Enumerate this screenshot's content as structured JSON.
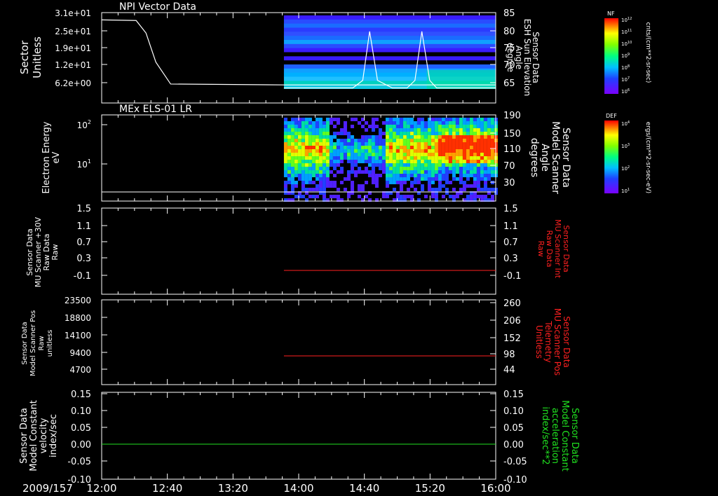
{
  "date_label": "2009/157",
  "x_ticks": [
    "12:00",
    "12:40",
    "13:20",
    "14:00",
    "14:40",
    "15:20",
    "16:00"
  ],
  "chart_data": [
    {
      "type": "line",
      "title": "NPI Vector Data",
      "ylabel_left": [
        "Sector",
        "Unitless"
      ],
      "ylabel_right": [
        "Sensor Data",
        "ESH Sun Elevation",
        "Angle",
        "degree"
      ],
      "left_ticks": [
        "3.1e+01",
        "2.5e+01",
        "1.9e+01",
        "1.2e+01",
        "6.2e+00"
      ],
      "right_ticks": [
        "85",
        "80",
        "75",
        "70",
        "65"
      ],
      "ylim_right": [
        62,
        85
      ],
      "colorbar": {
        "label": "NF",
        "unit": "cnts/(cm**2-sr-sec)",
        "ticks": [
          "10^12",
          "10^11",
          "10^10",
          "10^9",
          "10^8",
          "10^7",
          "10^6"
        ]
      },
      "series": [
        {
          "name": "Sector",
          "x_hours": [
            12.0,
            12.35,
            12.45,
            12.55,
            12.7,
            13.85,
            16.0
          ],
          "values": [
            28.5,
            28.3,
            24,
            14,
            6.5,
            6.2,
            6.2
          ]
        },
        {
          "name": "ESH Sun Elevation Angle",
          "x_hours": [
            13.85,
            14.55,
            14.65,
            14.72,
            14.8,
            14.95,
            15.1,
            15.18,
            15.25,
            15.33,
            15.4,
            15.5,
            16.0
          ],
          "values": [
            65,
            65,
            67,
            80,
            67,
            65,
            65,
            67,
            80,
            67,
            65,
            65,
            65
          ]
        }
      ]
    },
    {
      "type": "heatmap",
      "title": "MEx ELS-01 LR",
      "ylabel_left": [
        "Electron Energy",
        "eV"
      ],
      "ylabel_right": [
        "Sensor Data",
        "Model Scanner",
        "Angle",
        "degrees"
      ],
      "left_ticks": [
        "10^2",
        "10^1"
      ],
      "right_ticks": [
        "190",
        "150",
        "110",
        "70",
        "30"
      ],
      "colorbar": {
        "label": "DEF",
        "unit": "ergs/(cm**2-sr-sec-eV)",
        "ticks": [
          "10^4",
          "10^3",
          "10^2",
          "10^1"
        ]
      },
      "series": [
        {
          "name": "Scanner Angle",
          "x_hours": [
            12.0,
            16.0
          ],
          "values": [
            10,
            10
          ]
        }
      ]
    },
    {
      "type": "line",
      "ylabel_left": [
        "Sensor Data",
        "MU Scanner +30V",
        "Raw Data",
        "Raw"
      ],
      "ylabel_right": [
        "Sensor Data",
        "MU Scanner Int",
        "Raw Data",
        "Raw"
      ],
      "left_ticks": [
        "1.5",
        "1.1",
        "0.7",
        "0.3",
        "-0.1"
      ],
      "right_ticks": [
        "1.5",
        "1.1",
        "0.7",
        "0.3",
        "-0.1"
      ],
      "ylim": [
        -0.5,
        1.5
      ],
      "series": [
        {
          "name": "MU Scanner Int",
          "color": "#ff2020",
          "x_hours": [
            13.85,
            16.0
          ],
          "values": [
            -0.05,
            -0.05
          ]
        }
      ]
    },
    {
      "type": "line",
      "ylabel_left": [
        "Sensor Data",
        "Model Scanner Pos",
        "Raw",
        "unitless"
      ],
      "ylabel_right": [
        "Sensor Data",
        "MU Scanner Pos",
        "Telemetry",
        "Unitless"
      ],
      "left_ticks": [
        "23500",
        "18800",
        "14100",
        "9400",
        "4700"
      ],
      "right_ticks": [
        "260",
        "206",
        "152",
        "98",
        "44"
      ],
      "ylim_right": [
        -10,
        260
      ],
      "series": [
        {
          "name": "MU Scanner Pos Telemetry",
          "color": "#ff2020",
          "x_hours": [
            13.85,
            16.0
          ],
          "values": [
            87,
            87
          ]
        }
      ]
    },
    {
      "type": "line",
      "ylabel_left": [
        "Sensor Data",
        "Model Constant",
        "velocity",
        "index/sec"
      ],
      "ylabel_right": [
        "Sensor Data",
        "Model Constant",
        "acceleration",
        "index/sec**2"
      ],
      "left_ticks": [
        "0.15",
        "0.10",
        "0.05",
        "0.00",
        "-0.05",
        "-0.10"
      ],
      "right_ticks": [
        "0.15",
        "0.10",
        "0.05",
        "0.00",
        "-0.05",
        "-0.10"
      ],
      "ylim": [
        -0.1,
        0.15
      ],
      "series": [
        {
          "name": "Model Constant acceleration",
          "color": "#20e020",
          "x_hours": [
            12.0,
            16.0
          ],
          "values": [
            0.0,
            0.0
          ]
        }
      ]
    }
  ]
}
